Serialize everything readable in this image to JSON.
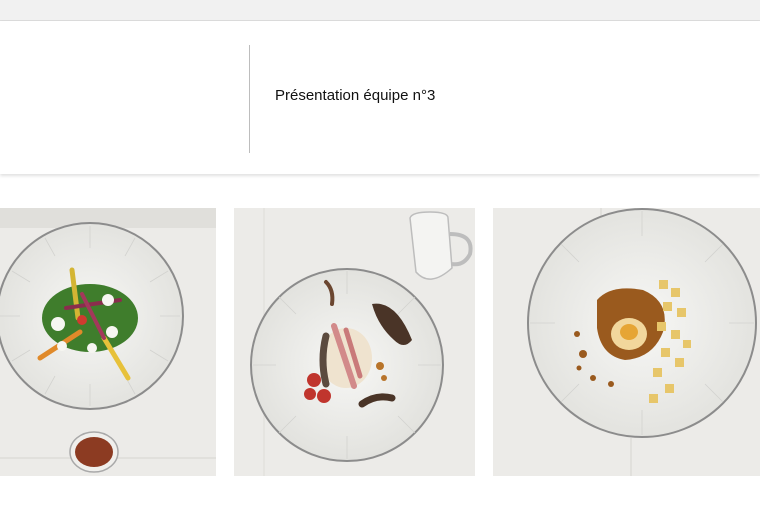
{
  "slide": {
    "title": "Présentation équipe n°3"
  },
  "photos": [
    {
      "subject": "plate-vegetables-green-sauce",
      "accent": "#3f7d2c"
    },
    {
      "subject": "plate-meat-and-mushroom",
      "accent": "#6b4630"
    },
    {
      "subject": "plate-egg-and-potatoes",
      "accent": "#9a5a1e"
    }
  ],
  "colors": {
    "tablecloth": "#e8e8e6",
    "plate": "#f3f3f1",
    "plate_rim": "#8f8f8f"
  }
}
